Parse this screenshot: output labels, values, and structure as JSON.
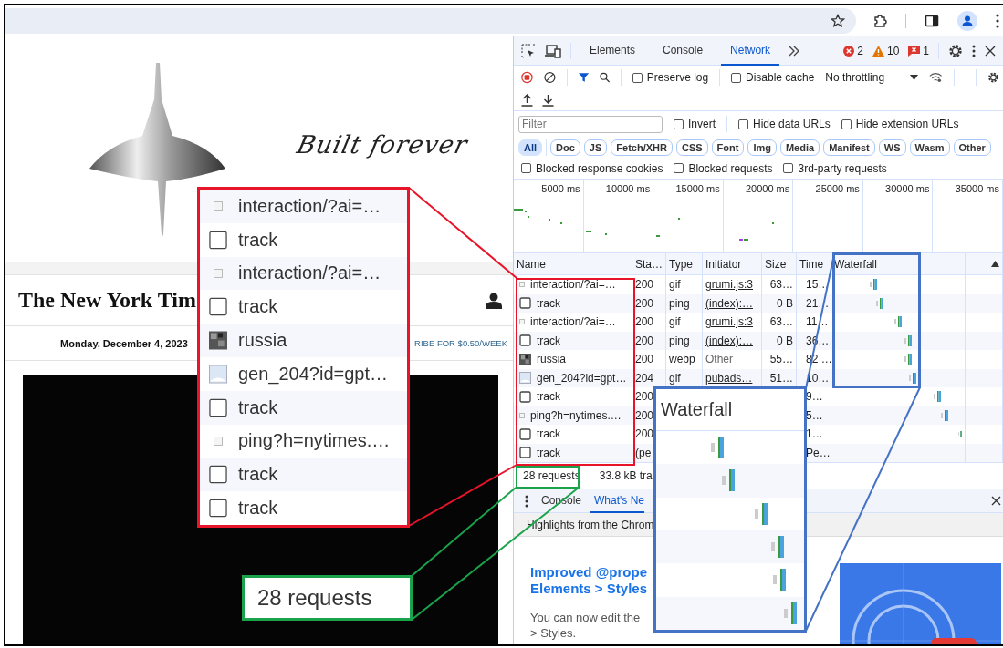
{
  "page": {
    "tagline": "Built forever",
    "logo": "The New York Tim",
    "date": "Monday, December 4, 2023",
    "subscribe_link": "RIBE FOR $0.50/WEEK"
  },
  "devtools": {
    "tabs": [
      {
        "label": "Elements",
        "selected": false
      },
      {
        "label": "Console",
        "selected": false
      },
      {
        "label": "Network",
        "selected": true
      }
    ],
    "issues": [
      {
        "kind": "error",
        "count": "2"
      },
      {
        "kind": "warning",
        "count": "10"
      },
      {
        "kind": "message",
        "count": "1"
      }
    ],
    "toolbar_checkboxes": [
      {
        "label": "Preserve log",
        "checked": false
      },
      {
        "label": "Disable cache",
        "checked": false
      }
    ],
    "throttling": "No throttling",
    "filter": {
      "placeholder": "Filter"
    },
    "filter_checkboxes": [
      {
        "label": "Invert",
        "checked": false
      },
      {
        "label": "Hide data URLs",
        "checked": false
      },
      {
        "label": "Hide extension URLs",
        "checked": false
      }
    ],
    "type_filters": [
      {
        "label": "All",
        "selected": true
      },
      {
        "label": "Doc",
        "selected": false
      },
      {
        "label": "JS",
        "selected": false
      },
      {
        "label": "Fetch/XHR",
        "selected": false
      },
      {
        "label": "CSS",
        "selected": false
      },
      {
        "label": "Font",
        "selected": false
      },
      {
        "label": "Img",
        "selected": false
      },
      {
        "label": "Media",
        "selected": false
      },
      {
        "label": "Manifest",
        "selected": false
      },
      {
        "label": "WS",
        "selected": false
      },
      {
        "label": "Wasm",
        "selected": false
      },
      {
        "label": "Other",
        "selected": false
      }
    ],
    "request_checkboxes": [
      {
        "label": "Blocked response cookies",
        "checked": false
      },
      {
        "label": "Blocked requests",
        "checked": false
      },
      {
        "label": "3rd-party requests",
        "checked": false
      }
    ],
    "timeline_labels": [
      "5000 ms",
      "10000 ms",
      "15000 ms",
      "20000 ms",
      "25000 ms",
      "30000 ms",
      "35000 ms"
    ],
    "columns": [
      "Name",
      "Sta…",
      "Type",
      "Initiator",
      "Size",
      "Time",
      "Waterfall"
    ],
    "rows": [
      {
        "kind": "pixel",
        "name": "interaction/?ai=…",
        "status": "200",
        "type": "gif",
        "initiator": "grumi.js:3",
        "initiator_link": true,
        "size": "63…",
        "time": "15…"
      },
      {
        "kind": "file",
        "name": "track",
        "status": "200",
        "type": "ping",
        "initiator": "(index):…",
        "initiator_link": true,
        "size": "0 B",
        "time": "21…"
      },
      {
        "kind": "pixel",
        "name": "interaction/?ai=…",
        "status": "200",
        "type": "gif",
        "initiator": "grumi.js:3",
        "initiator_link": true,
        "size": "63…",
        "time": "11…"
      },
      {
        "kind": "file",
        "name": "track",
        "status": "200",
        "type": "ping",
        "initiator": "(index):…",
        "initiator_link": true,
        "size": "0 B",
        "time": "36…"
      },
      {
        "kind": "thumbnail",
        "name": "russia",
        "status": "200",
        "type": "webp",
        "initiator": "Other",
        "initiator_link": false,
        "size": "55…",
        "time": "82 …"
      },
      {
        "kind": "image",
        "name": "gen_204?id=gpt…",
        "status": "204",
        "type": "gif",
        "initiator": "pubads…",
        "initiator_link": true,
        "size": "51…",
        "time": "10…"
      },
      {
        "kind": "file",
        "name": "track",
        "status": "200",
        "time": "9…"
      },
      {
        "kind": "pixel",
        "name": "ping?h=nytimes.…",
        "status": "200",
        "time": "5…"
      },
      {
        "kind": "file",
        "name": "track",
        "status": "200",
        "time": "1…"
      },
      {
        "kind": "file",
        "name": "track",
        "status": "(pe",
        "time": "Pe…"
      }
    ],
    "summary": [
      "28 requests",
      "33.8 kB tra"
    ],
    "drawer": {
      "tabs": [
        {
          "label": "Console",
          "selected": false
        },
        {
          "label": "What's Ne",
          "selected": true
        }
      ],
      "banner": "Highlights from the Chrom",
      "headline": [
        "Improved @prope",
        "Elements > Styles"
      ],
      "body": [
        "You can now edit the",
        "> Styles."
      ]
    }
  },
  "callouts": {
    "name_zoom": [
      {
        "kind": "pixel",
        "name": "interaction/?ai=…"
      },
      {
        "kind": "file",
        "name": "track"
      },
      {
        "kind": "pixel",
        "name": "interaction/?ai=…"
      },
      {
        "kind": "file",
        "name": "track"
      },
      {
        "kind": "thumbnail",
        "name": "russia"
      },
      {
        "kind": "image",
        "name": "gen_204?id=gpt…"
      },
      {
        "kind": "file",
        "name": "track"
      },
      {
        "kind": "pixel",
        "name": "ping?h=nytimes.…"
      },
      {
        "kind": "file",
        "name": "track"
      },
      {
        "kind": "file",
        "name": "track"
      }
    ],
    "requests_zoom": "28 requests",
    "waterfall_zoom": {
      "title": "Waterfall"
    }
  }
}
